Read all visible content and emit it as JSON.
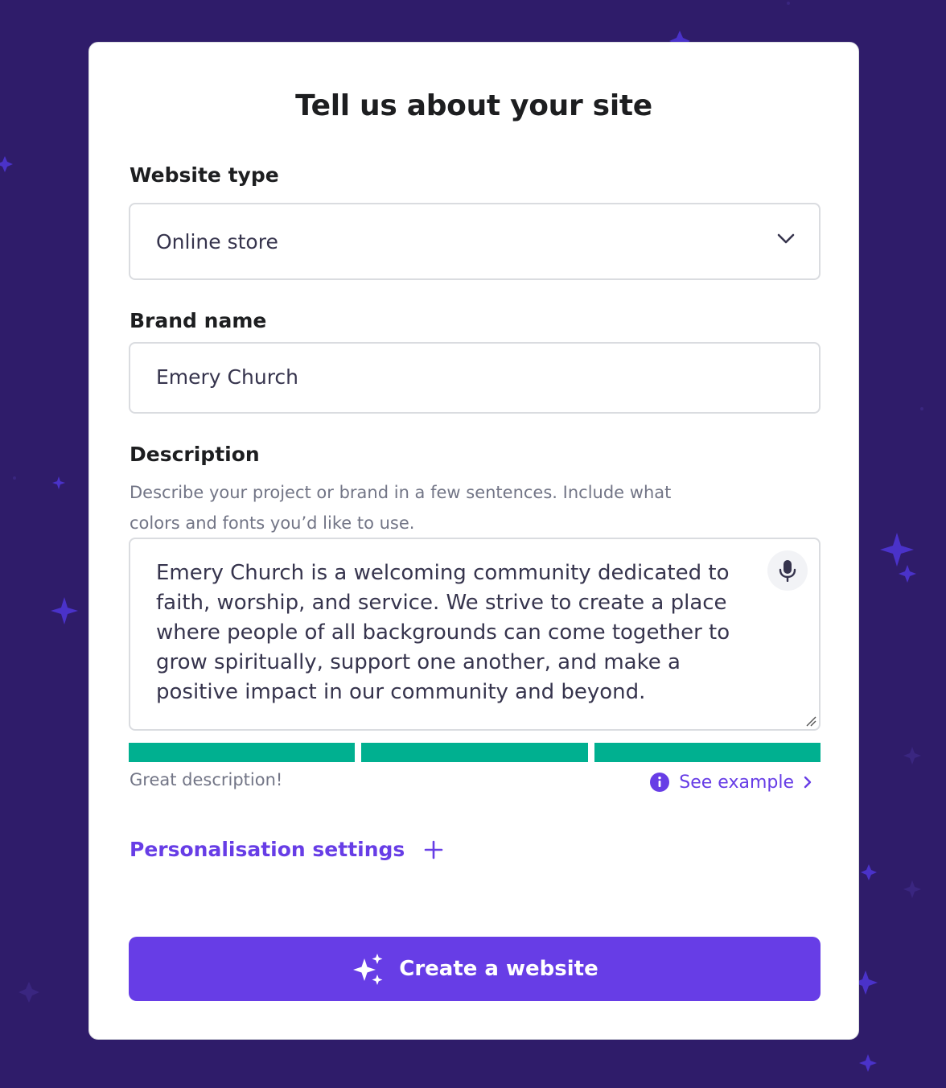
{
  "colors": {
    "background": "#2f1c6a",
    "accent": "#673de6",
    "success": "#00b090",
    "text": "#1d1e20",
    "muted": "#727586"
  },
  "form": {
    "title": "Tell us about your site",
    "website_type": {
      "label": "Website type",
      "value": "Online store",
      "icon": "chevron-down-icon"
    },
    "brand_name": {
      "label": "Brand name",
      "value": "Emery Church"
    },
    "description": {
      "label": "Description",
      "hint": "Describe your project or brand in a few sentences. Include what colors and fonts you’d like to use.",
      "value": "Emery Church is a welcoming community dedicated to faith, worship, and service. We strive to create a place where people of all backgrounds can come together to grow spiritually, support one another, and make a positive impact in our community and beyond.",
      "mic_icon": "microphone-icon",
      "strength": {
        "segments_filled": 3,
        "segments_total": 3,
        "message": "Great description!"
      },
      "see_example_label": "See example"
    },
    "personalisation": {
      "label": "Personalisation settings",
      "icon": "plus-icon"
    },
    "submit": {
      "label": "Create a website",
      "icon": "sparkles-icon"
    }
  }
}
